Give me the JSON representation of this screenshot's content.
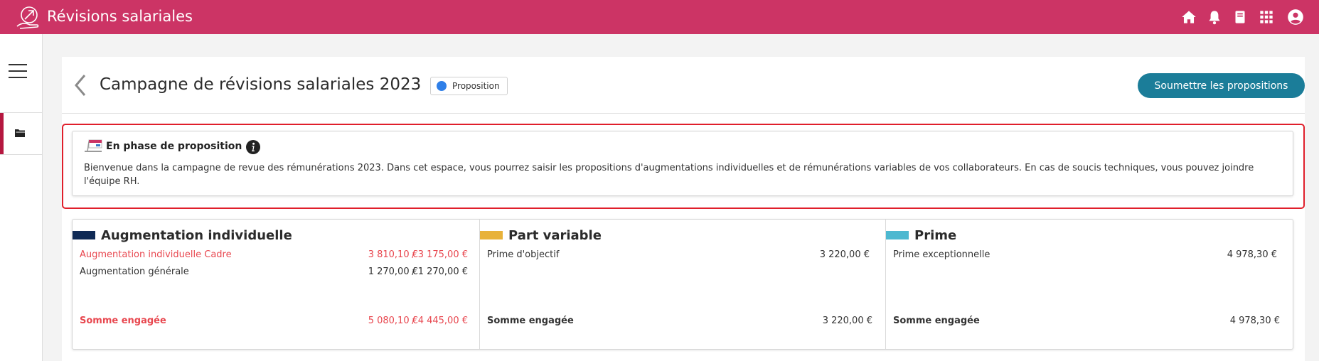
{
  "app": {
    "title": "Révisions salariales"
  },
  "top_icons": [
    "home-icon",
    "bell-icon",
    "book-icon",
    "apps-grid-icon",
    "user-account-icon"
  ],
  "colors": {
    "topbar": "#cc3465",
    "accent_button": "#1b7d99",
    "alert_red": "#e01f2b",
    "status_dot": "#2f7fe8",
    "augmentation": "#0f2a55",
    "part_variable": "#e8b23a",
    "prime": "#4db8d0"
  },
  "page": {
    "title": "Campagne de révisions salariales 2023",
    "status": "Proposition",
    "submit_label": "Soumettre les propositions"
  },
  "notice": {
    "title": "En phase de proposition",
    "text": "Bienvenue dans la campagne de revue des rémunérations 2023. Dans cet espace, vous pourrez saisir les propositions d'augmentations individuelles et de rémunérations variables de vos collaborateurs. En cas de soucis techniques, vous pouvez joindre l'équipe RH."
  },
  "budgets": {
    "augmentation": {
      "title": "Augmentation individuelle",
      "rows": [
        {
          "label": "Augmentation individuelle Cadre",
          "engaged": "3 810,10 €",
          "budget": "/ 3 175,00 €"
        },
        {
          "label": "Augmentation générale",
          "engaged": "1 270,00 €",
          "budget": "/ 1 270,00 €"
        }
      ],
      "total": {
        "label": "Somme engagée",
        "engaged": "5 080,10 €",
        "budget": "/ 4 445,00 €"
      }
    },
    "part_variable": {
      "title": "Part variable",
      "rows": [
        {
          "label": "Prime d'objectif",
          "amount": "3 220,00 €"
        }
      ],
      "total": {
        "label": "Somme engagée",
        "amount": "3 220,00 €"
      }
    },
    "prime": {
      "title": "Prime",
      "rows": [
        {
          "label": "Prime exceptionnelle",
          "amount": "4 978,30 €"
        }
      ],
      "total": {
        "label": "Somme engagée",
        "amount": "4 978,30 €"
      }
    }
  }
}
